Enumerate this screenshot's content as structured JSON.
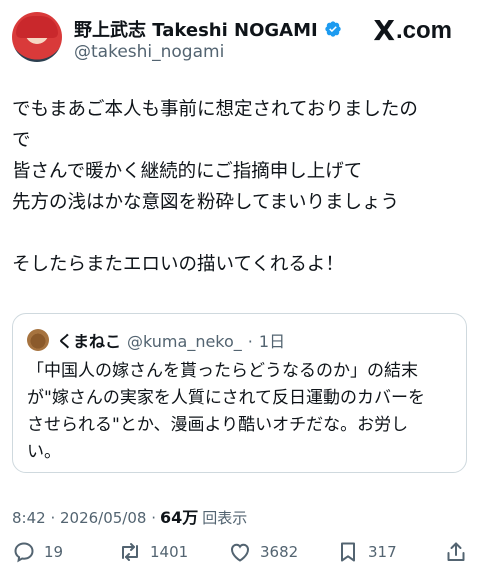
{
  "header": {
    "display_name": "野上武志 Takeshi NOGAMI",
    "handle": "@takeshi_nogami",
    "brand_x": "X",
    "brand_domain": ".com"
  },
  "tweet": {
    "text": "でもまあご本人も事前に想定されておりましたの\nで\n皆さんで暖かく継続的にご指摘申し上げて\n先方の浅はかな意図を粉砕してまいりましょう\n\nそしたらまたエロいの描いてくれるよ！"
  },
  "quote": {
    "display_name": "くまねこ",
    "handle": "@kuma_neko_",
    "separator": "·",
    "age": "1日",
    "text": "「中国人の嫁さんを貰ったらどうなるのか」の結末\nが\"嫁さんの実家を人質にされて反日運動のカバーを\nさせられる\"とか、漫画より酷いオチだな。お労し\nい。"
  },
  "meta": {
    "timestamp": "8:42 · 2026/05/08 ·",
    "views": "64万",
    "views_label": "回表示"
  },
  "actions": {
    "replies": "19",
    "reposts": "1401",
    "likes": "3682",
    "bookmarks": "317"
  },
  "colors": {
    "verified": "#1d9bf0",
    "secondary_text": "#536471",
    "border": "#cfd9de"
  }
}
